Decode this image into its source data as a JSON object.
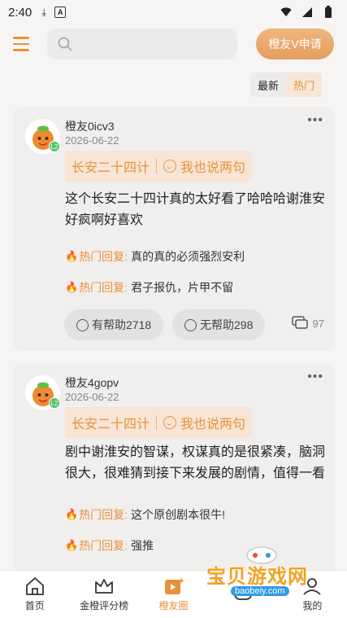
{
  "status_bar": {
    "time": "2:40"
  },
  "header": {
    "search_placeholder": "",
    "vip_button": "橙友V申请"
  },
  "sort": {
    "latest": "最新",
    "hot": "热门"
  },
  "posts": [
    {
      "username": "橙友0icv3",
      "date": "2026-06-22",
      "level": "L2",
      "topic": "长安二十四计",
      "topic_action": "我也说两句",
      "content": "这个长安二十四计真的太好看了哈哈哈谢淮安好疯啊好喜欢",
      "replies": [
        {
          "label": "热门回复:",
          "text": "真的真的必须强烈安利"
        },
        {
          "label": "热门回复:",
          "text": "君子报仇，片甲不留"
        }
      ],
      "helpful": "有帮助2718",
      "unhelpful": "无帮助298",
      "comments": "97"
    },
    {
      "username": "橙友4gopv",
      "date": "2026-06-22",
      "level": "L2",
      "topic": "长安二十四计",
      "topic_action": "我也说两句",
      "content": "剧中谢淮安的智谋，权谋真的是很紧凑，脑洞很大，很难猜到接下来发展的剧情，值得一看",
      "replies": [
        {
          "label": "热门回复:",
          "text": "这个原创剧本很牛!"
        },
        {
          "label": "热门回复:",
          "text": "强推"
        }
      ]
    }
  ],
  "tabs": [
    {
      "label": "首页",
      "icon": "home-icon"
    },
    {
      "label": "金橙评分榜",
      "icon": "crown-icon"
    },
    {
      "label": "橙友圈",
      "icon": "video-star-icon"
    },
    {
      "label": "",
      "icon": "game-icon"
    },
    {
      "label": "我的",
      "icon": "profile-icon"
    }
  ],
  "watermark": {
    "text": "宝贝游戏网",
    "url": "baobeiy.com"
  },
  "colors": {
    "accent": "#e8913b",
    "card_bg": "#f1efed",
    "page_bg": "#f7f5f4"
  }
}
